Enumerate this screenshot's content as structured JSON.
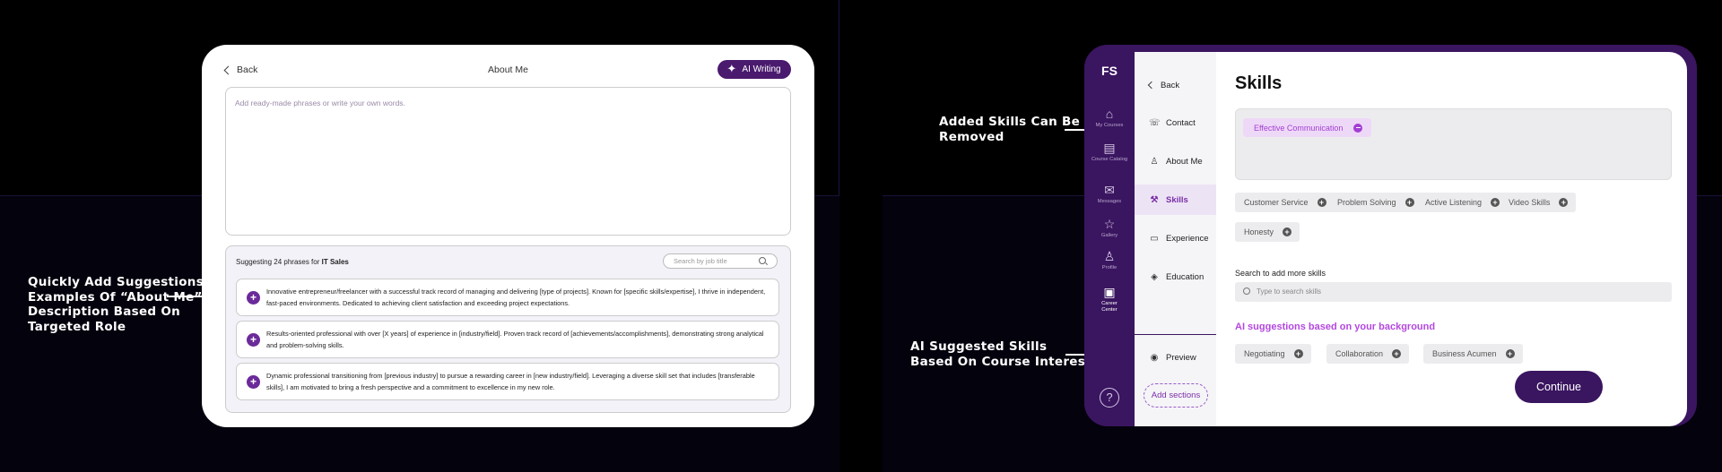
{
  "annotations": {
    "about_me": [
      "Quickly Add Suggestions/",
      "Examples Of “About Me”",
      "Description Based On",
      "Targeted Role"
    ],
    "removed": [
      "Added Skills Can Be",
      "Removed"
    ],
    "ai_suggested": [
      "AI Suggested Skills",
      "Based On Course Interest"
    ]
  },
  "about_me_screen": {
    "back_label": "Back",
    "title": "About Me",
    "ai_writing_label": "AI Writing",
    "textarea_placeholder": "Add ready-made phrases or write your own words.",
    "suggest_prefix": "Suggesting  24 phrases for ",
    "suggest_role": "IT Sales",
    "job_search_placeholder": "Search by job title",
    "phrases": [
      "Innovative entrepreneur/freelancer with a successful track record of managing and delivering [type of projects]. Known for [specific skills/expertise], I thrive in independent, fast-paced environments. Dedicated to achieving client satisfaction and exceeding project expectations.",
      "Results-oriented professional with over [X years] of experience in [industry/field]. Proven track record of [achievements/accomplishments], demonstrating strong analytical and problem-solving skills.",
      "Dynamic professional transitioning from [previous industry] to pursue a rewarding career in [new industry/field]. Leveraging a diverse skill set that includes [transferable skills], I am motivated to bring a fresh perspective and a commitment to excellence in my new role."
    ]
  },
  "skills_screen": {
    "logo": "FS",
    "rail": [
      {
        "label": "My Courses",
        "icon": "home-icon"
      },
      {
        "label": "Course Catalog",
        "icon": "catalog-icon"
      },
      {
        "label": "Messages",
        "icon": "mail-icon"
      },
      {
        "label": "Gallery",
        "icon": "star-icon"
      },
      {
        "label": "Profile",
        "icon": "user-icon"
      },
      {
        "label": "Career Center",
        "icon": "briefcase-icon"
      }
    ],
    "back_label": "Back",
    "sections": [
      "Contact",
      "About Me",
      "Skills",
      "Experience",
      "Education"
    ],
    "preview_label": "Preview",
    "add_sections_label": "Add sections",
    "heading": "Skills",
    "added_skill": "Effective Communication",
    "suggested_skills": [
      "Customer Service",
      "Problem Solving",
      "Active Listening",
      "Video Skills",
      "Honesty"
    ],
    "search_label": "Search to add more skills",
    "search_placeholder": "Type to search skills",
    "ai_heading": "AI suggestions based on your background",
    "ai_skills": [
      "Negotiating",
      "Collaboration",
      "Business Acumen"
    ],
    "continue_label": "Continue",
    "colors": {
      "brand": "#3a1560",
      "accent": "#b447e0"
    }
  }
}
